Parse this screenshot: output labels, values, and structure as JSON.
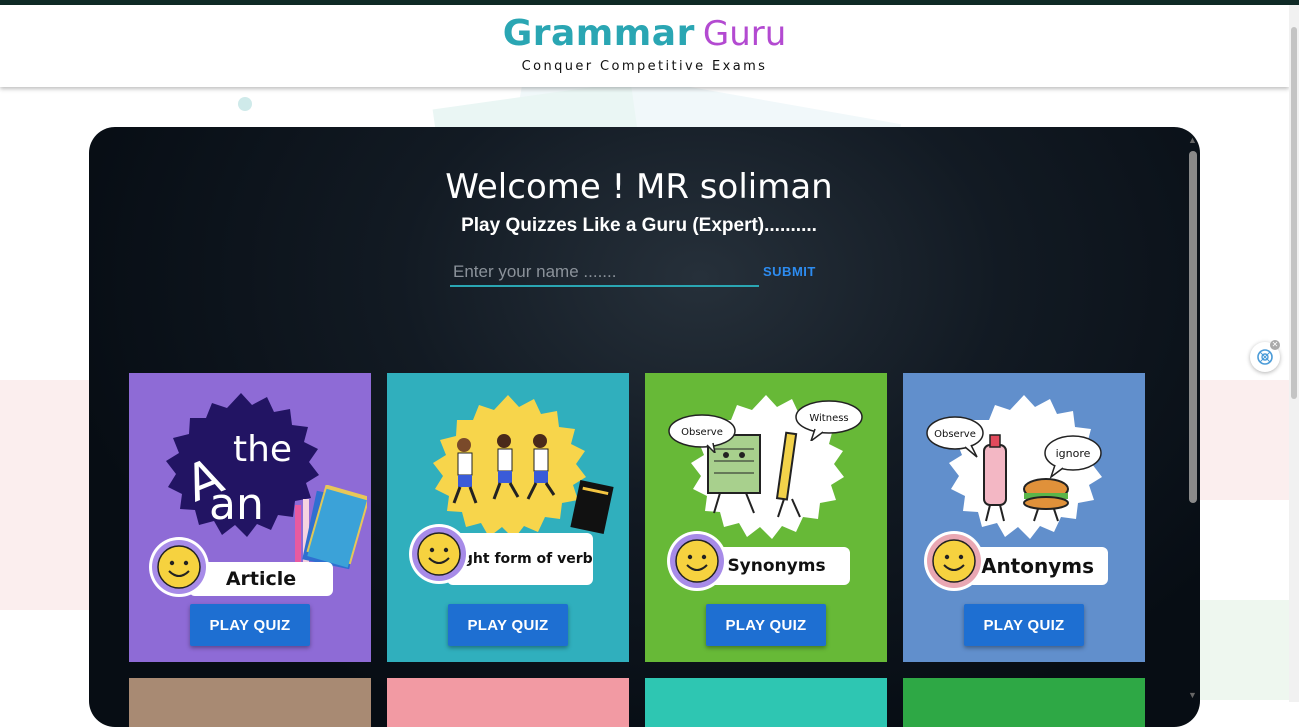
{
  "header": {
    "brand_part1": "Grammar",
    "brand_part2": "Guru",
    "tagline": "Conquer Competitive Exams"
  },
  "hero": {
    "welcome": "Welcome ! MR soliman",
    "subtitle": "Play Quizzes Like a Guru (Expert)..........",
    "name_placeholder": "Enter your name .......",
    "submit_label": "SUBMIT"
  },
  "cards": [
    {
      "title": "Article",
      "button": "PLAY QUIZ",
      "color": "#8e6bd6",
      "badge_words": [
        "A",
        "the",
        "an"
      ]
    },
    {
      "title": "Right form of verb",
      "button": "PLAY QUIZ",
      "color": "#30afbd"
    },
    {
      "title": "Synonyms",
      "button": "PLAY QUIZ",
      "color": "#67b937",
      "bubbles": [
        "Observe",
        "Witness"
      ]
    },
    {
      "title": "Antonyms",
      "button": "PLAY QUIZ",
      "color": "#618fcc",
      "bubbles": [
        "Observe",
        "ignore"
      ]
    }
  ],
  "next_row_colors": [
    "#a88a73",
    "#f29aa3",
    "#2ec6b2",
    "#2ea845"
  ],
  "icons": {
    "chat_fab": "chatgpt-icon",
    "close": "close-icon"
  }
}
